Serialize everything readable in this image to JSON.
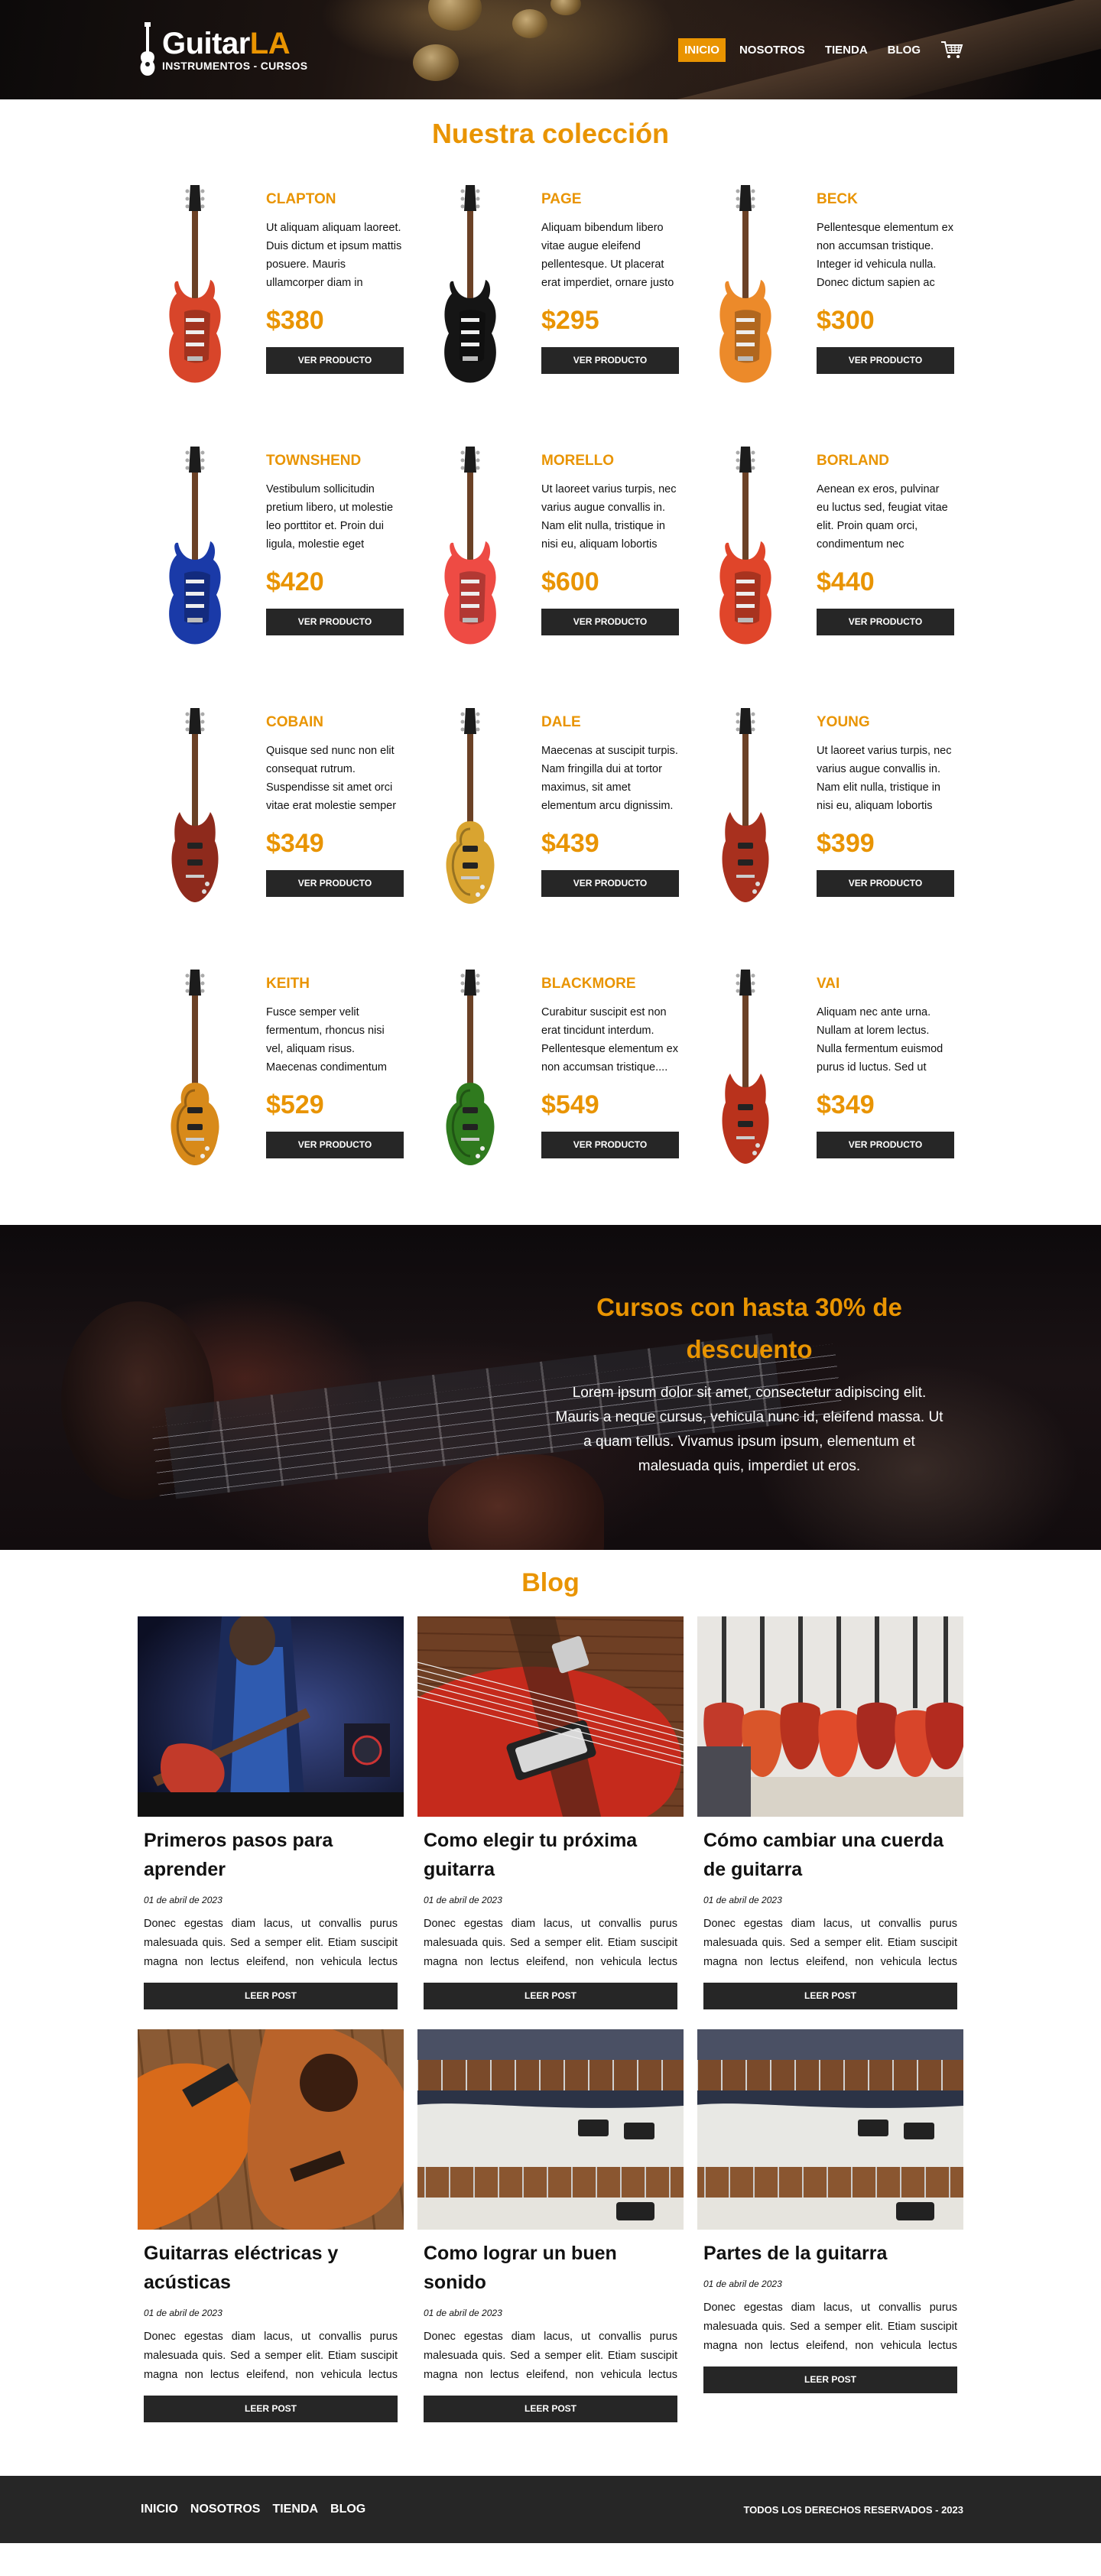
{
  "header": {
    "logo_main": "Guitar",
    "logo_accent": "LA",
    "logo_sub": "INSTRUMENTOS - CURSOS",
    "nav": [
      "INICIO",
      "NOSOTROS",
      "TIENDA",
      "BLOG"
    ],
    "active_nav": "INICIO",
    "cart_icon": "shopping-cart-icon"
  },
  "collection": {
    "title": "Nuestra colección",
    "button_label": "VER PRODUCTO",
    "products": [
      {
        "name": "CLAPTON",
        "desc": "Ut aliquam aliquam laoreet. Duis dictum et ipsum mattis posuere. Mauris ullamcorper diam in hendrerit pulvinar....",
        "price": "$380",
        "color": "#d8452a",
        "style": "strat"
      },
      {
        "name": "PAGE",
        "desc": "Aliquam bibendum libero vitae augue eleifend pellentesque. Ut placerat erat imperdiet, ornare justo sit amet, gravida....",
        "price": "$295",
        "color": "#151515",
        "style": "strat"
      },
      {
        "name": "BECK",
        "desc": "Pellentesque elementum ex non accumsan tristique. Integer id vehicula nulla. Donec dictum sapien ac mi....",
        "price": "$300",
        "color": "#ec8a2a",
        "style": "strat"
      },
      {
        "name": "TOWNSHEND",
        "desc": "Vestibulum sollicitudin pretium libero, ut molestie leo porttitor et. Proin dui ligula, molestie eget pellentesque sit....",
        "price": "$420",
        "color": "#1a3aa8",
        "style": "strat"
      },
      {
        "name": "MORELLO",
        "desc": "Ut laoreet varius turpis, nec varius augue convallis in. Nam elit nulla, tristique in nisi eu, aliquam lobortis felis....",
        "price": "$600",
        "color": "#ee4b44",
        "style": "strat"
      },
      {
        "name": "BORLAND",
        "desc": "Aenean ex eros, pulvinar eu luctus sed, feugiat vitae elit. Proin quam orci, condimentum nec malesuada in, mattis a....",
        "price": "$440",
        "color": "#e0452a",
        "style": "strat"
      },
      {
        "name": "COBAIN",
        "desc": "Quisque sed nunc non elit consequat rutrum. Suspendisse sit amet orci vitae erat molestie semper a vel erat....",
        "price": "$349",
        "color": "#8e2a1c",
        "style": "sg"
      },
      {
        "name": "DALE",
        "desc": "Maecenas at suscipit turpis. Nam fringilla dui at tortor maximus, sit amet elementum arcu dignissim. Morbi quis....",
        "price": "$439",
        "color": "#d9a430",
        "style": "lp"
      },
      {
        "name": "YOUNG",
        "desc": "Ut laoreet varius turpis, nec varius augue convallis in. Nam elit nulla, tristique in nisi eu, aliquam lobortis felis....",
        "price": "$399",
        "color": "#a8301e",
        "style": "sg"
      },
      {
        "name": "KEITH",
        "desc": "Fusce semper velit fermentum, rhoncus nisi vel, aliquam risus. Maecenas condimentum interdum sagittis....",
        "price": "$529",
        "color": "#d88a1a",
        "style": "lp"
      },
      {
        "name": "BLACKMORE",
        "desc": "Curabitur suscipit est non erat tincidunt interdum. Pellentesque elementum ex non accumsan tristique....",
        "price": "$549",
        "color": "#2f7a1e",
        "style": "lp"
      },
      {
        "name": "VAI",
        "desc": "Aliquam nec ante urna. Nullam at lorem lectus. Nulla fermentum euismod purus id luctus. Sed ut malesuada ex....",
        "price": "$349",
        "color": "#b9321c",
        "style": "sg"
      }
    ]
  },
  "courses": {
    "title": "Cursos con hasta 30% de descuento",
    "text": "Lorem ipsum dolor sit amet, consectetur adipiscing elit. Mauris a neque cursus, vehicula nunc id, eleifend massa. Ut a quam tellus. Vivamus ipsum ipsum, elementum et malesuada quis, imperdiet ut eros."
  },
  "blog": {
    "title": "Blog",
    "button_label": "LEER POST",
    "posts": [
      {
        "title": "Primeros pasos para aprender",
        "date": "01 de abril de 2023",
        "excerpt": "Donec egestas diam lacus, ut convallis purus malesuada quis. Sed a semper elit. Etiam suscipit magna non lectus eleifend, non vehicula lectus ultrices. Phasellus fermentu....",
        "image": "player"
      },
      {
        "title": "Como elegir tu próxima guitarra",
        "date": "01 de abril de 2023",
        "excerpt": "Donec egestas diam lacus, ut convallis purus malesuada quis. Sed a semper elit. Etiam suscipit magna non lectus eleifend, non vehicula lectus ultrices. Phasellus fermentu....",
        "image": "redbody"
      },
      {
        "title": "Cómo cambiar una cuerda de guitarra",
        "date": "01 de abril de 2023",
        "excerpt": "Donec egestas diam lacus, ut convallis purus malesuada quis. Sed a semper elit. Etiam suscipit magna non lectus eleifend, non vehicula lectus ultrices. Phasellus fermentu....",
        "image": "shop"
      },
      {
        "title": "Guitarras eléctricas y acústicas",
        "date": "01 de abril de 2023",
        "excerpt": "Donec egestas diam lacus, ut convallis purus malesuada quis. Sed a semper elit. Etiam suscipit magna non lectus eleifend, non vehicula lectus ultrices. Phasellus fermentu....",
        "image": "acoustic"
      },
      {
        "title": "Como lograr un buen sonido",
        "date": "01 de abril de 2023",
        "excerpt": "Donec egestas diam lacus, ut convallis purus malesuada quis. Sed a semper elit. Etiam suscipit magna non lectus eleifend, non vehicula lectus ultrices. Phasellus fermentu....",
        "image": "teles"
      },
      {
        "title": "Partes de la guitarra",
        "date": "01 de abril de 2023",
        "excerpt": "Donec egestas diam lacus, ut convallis purus malesuada quis. Sed a semper elit. Etiam suscipit magna non lectus eleifend, non vehicula lectus ultrices. Phasellus fermentu....",
        "image": "teles"
      }
    ]
  },
  "footer": {
    "nav": [
      "INICIO",
      "NOSOTROS",
      "TIENDA",
      "BLOG"
    ],
    "copyright": "TODOS LOS DERECHOS RESERVADOS - 2023"
  },
  "colors": {
    "accent": "#e99401",
    "dark": "#262626"
  }
}
